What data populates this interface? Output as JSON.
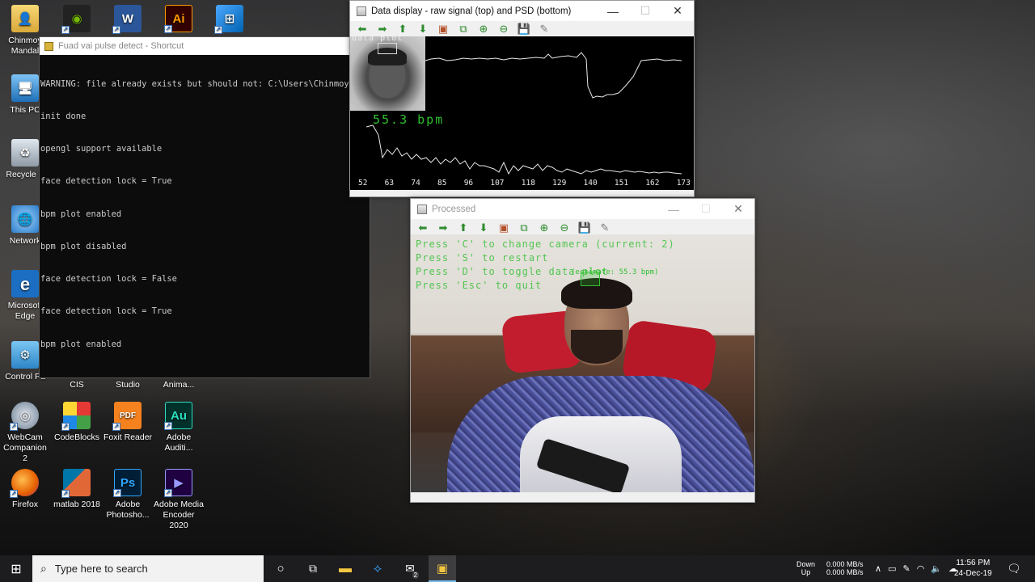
{
  "desktop": {
    "icons": [
      {
        "label": "Chinmoy Mandal",
        "icon": "user-folder-icon"
      },
      {
        "label": "This PC",
        "icon": "computer-icon"
      },
      {
        "label": "Recycle B",
        "icon": "recycle-bin-icon"
      },
      {
        "label": "Network",
        "icon": "network-icon"
      },
      {
        "label": "Microsoft Edge",
        "icon": "edge-icon"
      },
      {
        "label": "Control Pa",
        "icon": "control-panel-icon"
      },
      {
        "label": "CIS",
        "icon": "nvidia-icon"
      },
      {
        "label": "Studio",
        "icon": "word-icon"
      },
      {
        "label": "Anima...",
        "icon": "illustrator-icon"
      },
      {
        "label": "WebCam Companion 2",
        "icon": "webcam-icon"
      },
      {
        "label": "CodeBlocks",
        "icon": "codeblocks-icon"
      },
      {
        "label": "Foxit Reader",
        "icon": "foxit-icon"
      },
      {
        "label": "Adobe Auditi...",
        "icon": "audition-icon"
      },
      {
        "label": "Firefox",
        "icon": "firefox-icon"
      },
      {
        "label": "matlab 2018",
        "icon": "matlab-icon"
      },
      {
        "label": "Adobe Photosho...",
        "icon": "photoshop-icon"
      },
      {
        "label": "Adobe Media Encoder 2020",
        "icon": "media-encoder-icon"
      }
    ],
    "top_icon_text": {
      "word": "W",
      "illustrator": "Ai",
      "audition": "Au",
      "photoshop": "Ps",
      "foxit": "PDF"
    }
  },
  "console": {
    "title": "Fuad vai pulse detect - Shortcut",
    "lines": [
      "WARNING: file already exists but should not: C:\\Users\\Chinmoy\\Ap",
      "init done",
      "opengl support available",
      "face detection lock = True",
      "bpm plot enabled",
      "bpm plot disabled",
      "face detection lock = False",
      "face detection lock = True",
      "bpm plot enabled"
    ]
  },
  "data_window": {
    "title": "Data display - raw signal (top) and PSD (bottom)",
    "plot_label": "data plot",
    "bpm_text": "55.3 bpm",
    "x_ticks": [
      "52",
      "63",
      "74",
      "85",
      "96",
      "107",
      "118",
      "129",
      "140",
      "151",
      "162",
      "173"
    ]
  },
  "processed_window": {
    "title": "Processed",
    "overlay_lines": [
      "Press 'C' to change camera (current: 2)",
      "Press 'S' to restart",
      "Press 'D' to toggle data plot",
      "Press 'Esc' to quit"
    ],
    "estimate_text": "(estimate: 55.3 bpm)"
  },
  "taskbar": {
    "search_placeholder": "Type here to search",
    "net_labels": {
      "down": "Down",
      "up": "Up",
      "down_rate": "0.000 MB/s",
      "up_rate": "0.000 MB/s"
    },
    "time": "11:56 PM",
    "date": "24-Dec-19",
    "mail_badge": "2"
  },
  "colors": {
    "overlay_green": "#2fbf2f",
    "plot_white": "#e8e8e8",
    "taskbar": "#1d1d1f"
  }
}
